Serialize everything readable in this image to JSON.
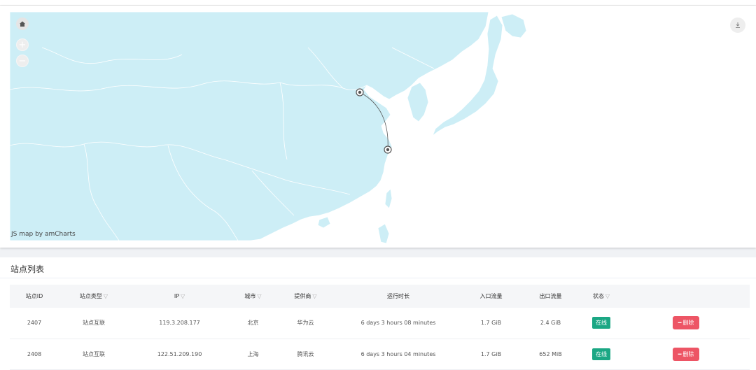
{
  "map": {
    "credit": "JS map by amCharts",
    "ocean_color": "#ffffff",
    "land_color": "#cdeef6",
    "border_color": "#ffffff",
    "markers": [
      {
        "city": "北京"
      },
      {
        "city": "上海"
      }
    ],
    "controls": {
      "home": "home-icon",
      "zoom_in": "+",
      "zoom_out": "−",
      "download": "download-icon"
    }
  },
  "list": {
    "title": "站点列表",
    "columns": [
      {
        "label": "站点ID",
        "filter": false
      },
      {
        "label": "站点类型",
        "filter": true
      },
      {
        "label": "IP",
        "filter": true
      },
      {
        "label": "城市",
        "filter": true
      },
      {
        "label": "提供商",
        "filter": true
      },
      {
        "label": "运行时长",
        "filter": false
      },
      {
        "label": "入口流量",
        "filter": false
      },
      {
        "label": "出口流量",
        "filter": false
      },
      {
        "label": "状态",
        "filter": true
      },
      {
        "label": "",
        "filter": false
      }
    ],
    "filter_icon": "▽",
    "rows": [
      {
        "id": "2407",
        "type": "站点互联",
        "ip": "119.3.208.177",
        "city": "北京",
        "provider": "华为云",
        "uptime": "6 days 3 hours 08 minutes",
        "in": "1.7 GiB",
        "out": "2.4 GiB",
        "status": "在线",
        "action": "删除"
      },
      {
        "id": "2408",
        "type": "站点互联",
        "ip": "122.51.209.190",
        "city": "上海",
        "provider": "腾讯云",
        "uptime": "6 days 3 hours 04 minutes",
        "in": "1.7 GiB",
        "out": "652 MiB",
        "status": "在线",
        "action": "删除"
      }
    ],
    "status_color": "#1ba784",
    "delete_color": "#ed5565"
  }
}
